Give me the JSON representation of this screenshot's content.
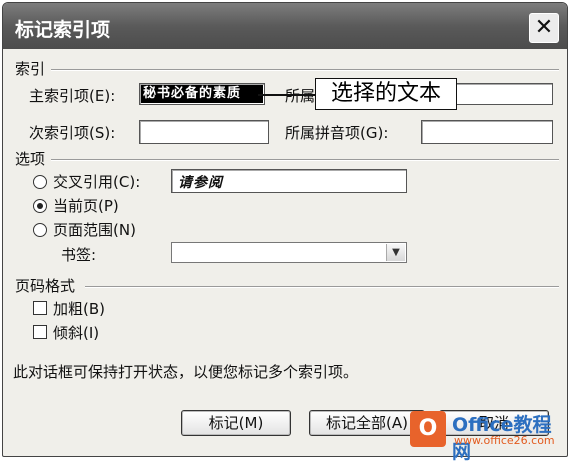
{
  "window": {
    "title": "标记索引项",
    "close_glyph": "✕"
  },
  "index_section": {
    "label": "索引",
    "main_entry_label": "主索引项",
    "main_entry_accel": "(E):",
    "main_entry_value": "秘书必备的素质",
    "main_pinyin_label": "所属",
    "sub_entry_label": "次索引项",
    "sub_entry_accel": "(S):",
    "sub_entry_value": "",
    "sub_pinyin_label": "所属拼音项",
    "sub_pinyin_accel": "(G):",
    "sub_pinyin_value": ""
  },
  "callout": {
    "text": "选择的文本"
  },
  "options_section": {
    "label": "选项",
    "cross_ref_label": "交叉引用",
    "cross_ref_accel": "(C):",
    "cross_ref_value": "请参阅",
    "current_page_label": "当前页",
    "current_page_accel": "(P)",
    "page_range_label": "页面范围",
    "page_range_accel": "(N)",
    "bookmark_label": "书签:",
    "bookmark_value": "",
    "selected_option": "current_page"
  },
  "page_format_section": {
    "label": "页码格式",
    "bold_label": "加粗",
    "bold_accel": "(B)",
    "bold_checked": false,
    "italic_label": "倾斜",
    "italic_accel": "(I)",
    "italic_checked": false
  },
  "hint_text": "此对话框可保持打开状态，以便您标记多个索引项。",
  "buttons": {
    "mark": "标记(M)",
    "mark_all": "标记全部(A)",
    "cancel": "取消"
  },
  "watermark": {
    "logo_glyph": "O",
    "title": "Office教程网",
    "url": "www.office26.com",
    "logo_color": "#e8632b",
    "title_color": "#2c6fc0"
  }
}
